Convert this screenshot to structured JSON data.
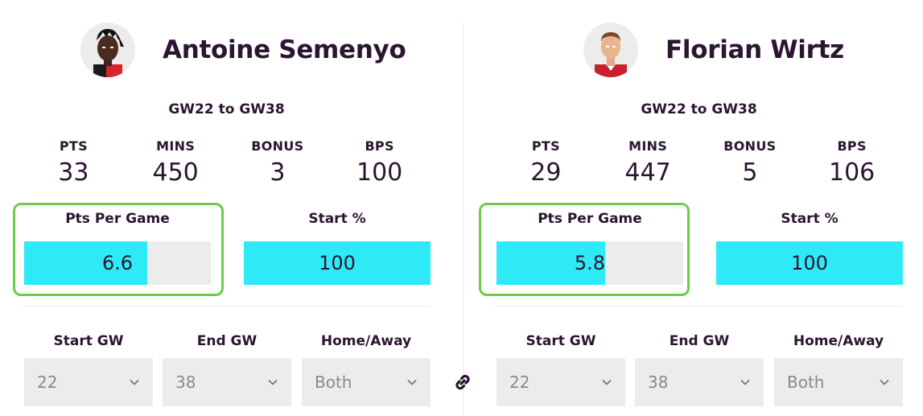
{
  "players": [
    {
      "name": "Antoine Semenyo",
      "range": "GW22 to GW38",
      "stats": [
        {
          "label": "PTS",
          "value": "33"
        },
        {
          "label": "MINS",
          "value": "450"
        },
        {
          "label": "BONUS",
          "value": "3"
        },
        {
          "label": "BPS",
          "value": "100"
        }
      ],
      "pts_per_game": {
        "label": "Pts Per Game",
        "value": "6.6",
        "fill_fraction": 0.66
      },
      "start_pct": {
        "label": "Start %",
        "value": "100",
        "fill_fraction": 1.0
      },
      "filters": [
        {
          "label": "Start GW",
          "value": "22"
        },
        {
          "label": "End GW",
          "value": "38"
        },
        {
          "label": "Home/Away",
          "value": "Both"
        }
      ]
    },
    {
      "name": "Florian Wirtz",
      "range": "GW22 to GW38",
      "stats": [
        {
          "label": "PTS",
          "value": "29"
        },
        {
          "label": "MINS",
          "value": "447"
        },
        {
          "label": "BONUS",
          "value": "5"
        },
        {
          "label": "BPS",
          "value": "106"
        }
      ],
      "pts_per_game": {
        "label": "Pts Per Game",
        "value": "5.8",
        "fill_fraction": 0.58
      },
      "start_pct": {
        "label": "Start %",
        "value": "100",
        "fill_fraction": 1.0
      },
      "filters": [
        {
          "label": "Start GW",
          "value": "22"
        },
        {
          "label": "End GW",
          "value": "38"
        },
        {
          "label": "Home/Away",
          "value": "Both"
        }
      ]
    }
  ],
  "link_icon": "link-icon",
  "colors": {
    "bar_fill": "#2eeaf7",
    "bar_track": "#ececec",
    "highlight": "#6acc4a",
    "text": "#2b1530"
  }
}
